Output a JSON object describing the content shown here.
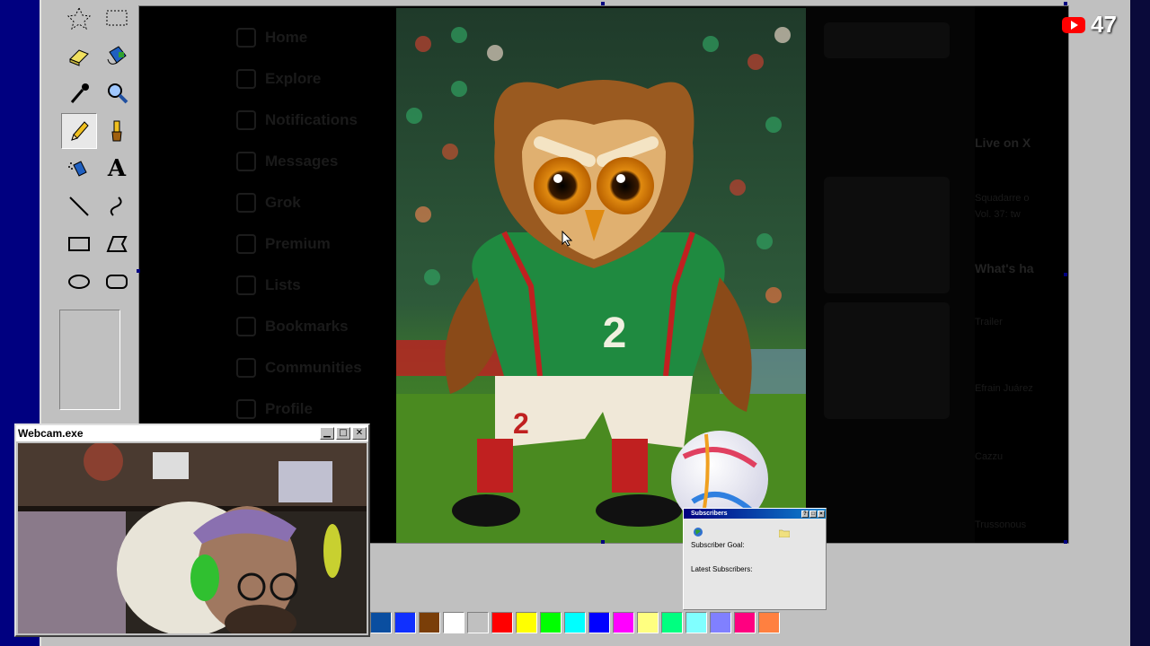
{
  "overlay": {
    "viewer_count": "47",
    "icon": "youtube-icon"
  },
  "paint": {
    "tools": [
      {
        "name": "free-select-icon"
      },
      {
        "name": "rect-select-icon"
      },
      {
        "name": "eraser-icon"
      },
      {
        "name": "fill-icon"
      },
      {
        "name": "color-picker-icon"
      },
      {
        "name": "magnifier-icon"
      },
      {
        "name": "pencil-icon",
        "active": true
      },
      {
        "name": "brush-icon"
      },
      {
        "name": "airbrush-icon"
      },
      {
        "name": "text-icon",
        "glyph": "A"
      },
      {
        "name": "line-icon"
      },
      {
        "name": "curve-icon"
      },
      {
        "name": "rectangle-icon"
      },
      {
        "name": "polygon-icon"
      },
      {
        "name": "ellipse-icon"
      },
      {
        "name": "rounded-rect-icon"
      }
    ],
    "palette": [
      "#0a4ea0",
      "#1030ff",
      "#7a3e08",
      "#ffffff",
      "#c0c0c0",
      "#ff0000",
      "#ffff00",
      "#00ff00",
      "#00ffff",
      "#0000ff",
      "#ff00ff",
      "#ffff80",
      "#00ff80",
      "#80ffff",
      "#8080ff",
      "#ff0080",
      "#ff8040"
    ]
  },
  "x_sidebar": {
    "items": [
      "Home",
      "Explore",
      "Notifications",
      "Messages",
      "Grok",
      "Premium",
      "Lists",
      "Bookmarks",
      "Communities",
      "Profile"
    ]
  },
  "x_right": {
    "live_heading": "Live on X",
    "live_line1": "Squadarre o",
    "live_line2": "Vol. 37: tw",
    "happening_heading": "What's ha",
    "trend1": "Trailer",
    "trend2": "Efrain Juárez",
    "trend3": "Cazzu",
    "trend4": "Trussonous"
  },
  "webcam": {
    "title": "Webcam.exe"
  },
  "subscribers": {
    "title": "Subscribers",
    "goal_label": "Subscriber Goal:",
    "latest_label": "Latest Subscribers:"
  },
  "artwork": {
    "jersey_number": "2",
    "shorts_number": "2"
  }
}
